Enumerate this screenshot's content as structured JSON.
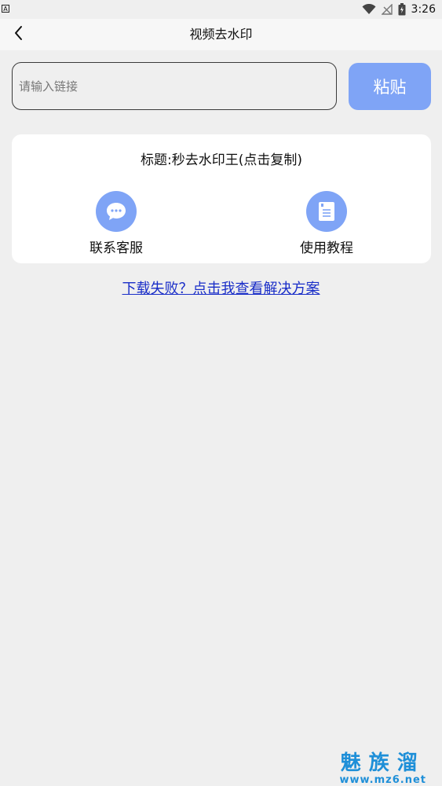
{
  "status_bar": {
    "time": "3:26",
    "left_indicator": "A"
  },
  "header": {
    "title": "视频去水印",
    "back_icon": "chevron-left-icon"
  },
  "input": {
    "placeholder": "请输入链接",
    "value": ""
  },
  "paste_button": {
    "label": "粘贴"
  },
  "card": {
    "title": "标题:秒去水印王(点击复制)",
    "actions": [
      {
        "label": "联系客服",
        "icon": "chat-bubble-icon"
      },
      {
        "label": "使用教程",
        "icon": "document-icon"
      }
    ]
  },
  "help_link": {
    "text": "下载失败？点击我查看解决方案"
  },
  "watermark": {
    "main": "魅族溜",
    "url": "www.mz6.net"
  },
  "colors": {
    "accent": "#7fa4f6",
    "link": "#1a2ec8",
    "background": "#efefef",
    "card": "#ffffff",
    "watermark": "#1e8fd8"
  }
}
